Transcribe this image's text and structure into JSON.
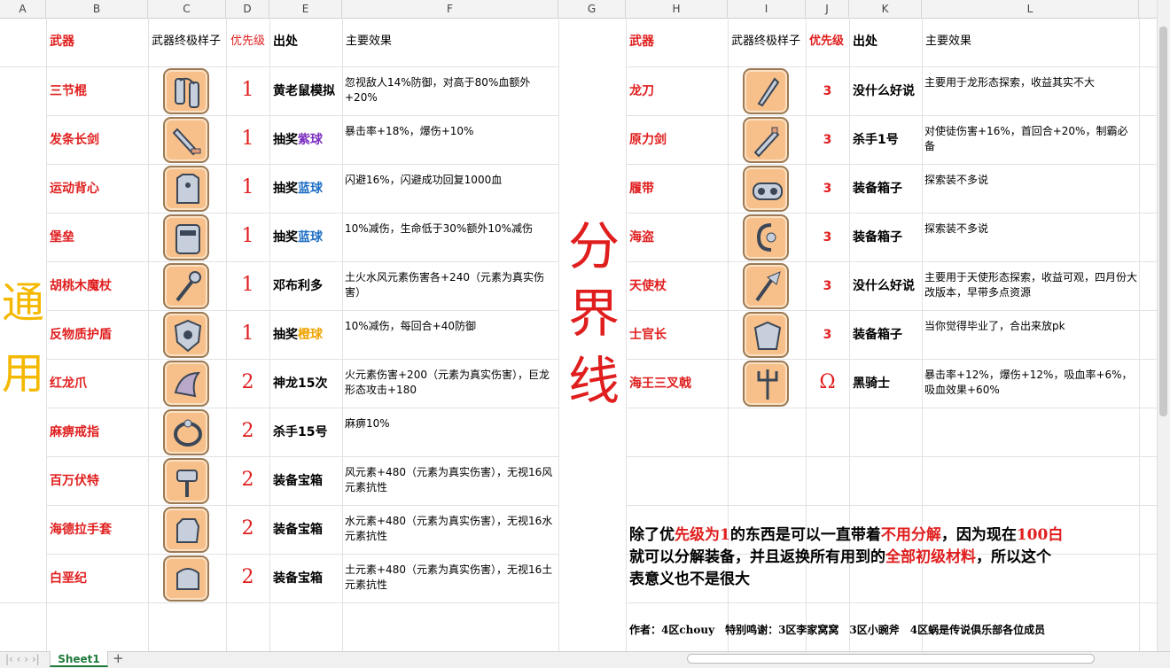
{
  "columns": [
    "A",
    "B",
    "C",
    "D",
    "E",
    "F",
    "G",
    "H",
    "I",
    "J",
    "K",
    "L"
  ],
  "left_headers": {
    "weapon": "武器",
    "look": "武器终极样子",
    "priority": "优先级",
    "source": "出处",
    "effect": "主要效果"
  },
  "right_headers": {
    "weapon": "武器",
    "look": "武器终极样子",
    "priority": "优先级",
    "source": "出处",
    "effect": "主要效果"
  },
  "side_label": [
    "通",
    "用"
  ],
  "divider_label": [
    "分",
    "界",
    "线"
  ],
  "left_rows": [
    {
      "name": "三节棍",
      "priority": "1",
      "source": "黄老鼠模拟",
      "effect": "忽视敌人14%防御，对高于80%血额外+20%",
      "icon": "nunchaku-icon"
    },
    {
      "name": "发条长剑",
      "priority": "1",
      "source_prefix": "抽奖",
      "source_color_word": "紫球",
      "source_color": "#7b2fbf",
      "effect": "暴击率+18%，爆伤+10%",
      "icon": "sword-icon"
    },
    {
      "name": "运动背心",
      "priority": "1",
      "source_prefix": "抽奖",
      "source_color_word": "蓝球",
      "source_color": "#1f6fc4",
      "effect": "闪避16%，闪避成功回复1000血",
      "icon": "vest-icon"
    },
    {
      "name": "堡垒",
      "priority": "1",
      "source_prefix": "抽奖",
      "source_color_word": "蓝球",
      "source_color": "#1f6fc4",
      "effect": "10%减伤，生命低于30%额外10%减伤",
      "icon": "fortress-icon"
    },
    {
      "name": "胡桃木魔杖",
      "priority": "1",
      "source": "邓布利多",
      "effect": "土火水风元素伤害各+240（元素为真实伤害）",
      "icon": "wand-icon"
    },
    {
      "name": "反物质护盾",
      "priority": "1",
      "source_prefix": "抽奖",
      "source_color_word": "橙球",
      "source_color": "#f0a400",
      "effect": "10%减伤，每回合+40防御",
      "icon": "shield-icon"
    },
    {
      "name": "红龙爪",
      "priority": "2",
      "source": "神龙15次",
      "effect": "火元素伤害+200（元素为真实伤害），巨龙形态攻击+180",
      "icon": "claw-icon"
    },
    {
      "name": "麻痹戒指",
      "priority": "2",
      "source": "杀手15号",
      "effect": "麻痹10%",
      "icon": "ring-icon"
    },
    {
      "name": "百万伏特",
      "priority": "2",
      "source": "装备宝箱",
      "effect": "风元素+480（元素为真实伤害），无视16风元素抗性",
      "icon": "hammer-icon"
    },
    {
      "name": "海德拉手套",
      "priority": "2",
      "source": "装备宝箱",
      "effect": "水元素+480（元素为真实伤害），无视16水元素抗性",
      "icon": "glove-icon"
    },
    {
      "name": "白垩纪",
      "priority": "2",
      "source": "装备宝箱",
      "effect": "土元素+480（元素为真实伤害），无视16土元素抗性",
      "icon": "fist-icon"
    }
  ],
  "right_rows": [
    {
      "name": "龙刀",
      "priority": "3",
      "source": "没什么好说",
      "effect": "主要用于龙形态探索，收益其实不大",
      "icon": "dagger-icon"
    },
    {
      "name": "原力剑",
      "priority": "3",
      "source": "杀手1号",
      "effect": "对使徒伤害+16%，首回合+20%，制霸必备",
      "icon": "force-sword-icon"
    },
    {
      "name": "履带",
      "priority": "3",
      "source": "装备箱子",
      "effect": "探索装不多说",
      "icon": "track-icon"
    },
    {
      "name": "海盗",
      "priority": "3",
      "source": "装备箱子",
      "effect": "探索装不多说",
      "icon": "hook-icon"
    },
    {
      "name": "天使杖",
      "priority": "3",
      "source": "没什么好说",
      "effect": "主要用于天使形态探索，收益可观，四月份大改版本，早带多点资源",
      "icon": "angel-staff-icon"
    },
    {
      "name": "士官长",
      "priority": "3",
      "source": "装备箱子",
      "effect": "当你觉得毕业了，合出来放pk",
      "icon": "armor-icon"
    },
    {
      "name": "海王三叉戟",
      "priority": "Ω",
      "source": "黑骑士",
      "effect": "暴击率+12%，爆伤+12%，吸血率+6%，吸血效果+60%",
      "icon": "trident-icon"
    }
  ],
  "note": {
    "p1": "除了优",
    "r1": "先级为1",
    "p2": "的东西是可以一直带着",
    "r2": "不用分解",
    "p3": "，因为现在",
    "r3": "100白",
    "p4": "就可以分解装备，并且返换所有用到的",
    "r4": "全部初级材料",
    "p5": "，所以这个",
    "p6": "表意义也不是很大"
  },
  "credits": "作者：4区chouy　特别鸣谢：3区李家窝窝　3区小豌斧　4区蜗是传说俱乐部各位成员",
  "sheet_tab": "Sheet1",
  "add_sheet": "+"
}
